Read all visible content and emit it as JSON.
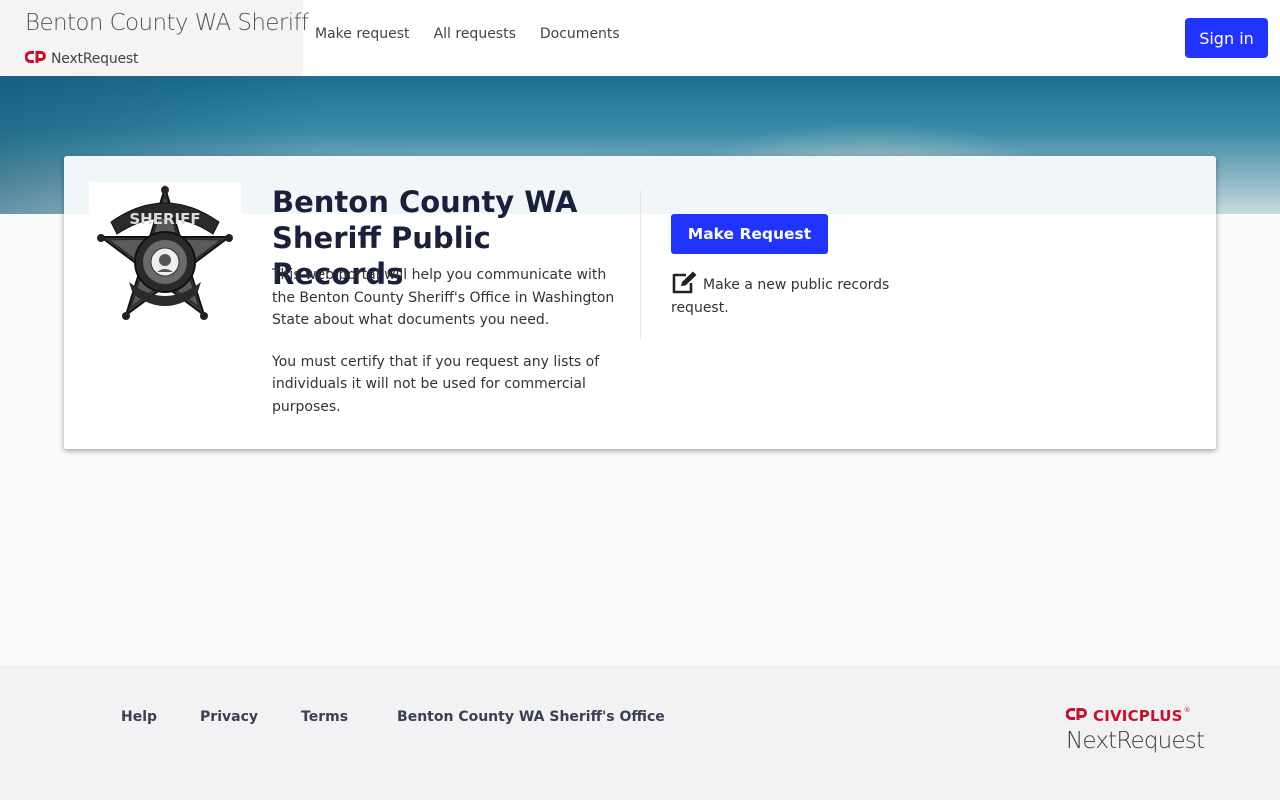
{
  "header": {
    "title": "Benton County WA Sheriff",
    "product_name": "NextRequest",
    "nav": [
      {
        "label": "Make request"
      },
      {
        "label": "All requests"
      },
      {
        "label": "Documents"
      }
    ],
    "sign_in_label": "Sign in"
  },
  "card": {
    "badge_icon": "sheriff-badge-icon",
    "title": "Benton County WA Sheriff Public Records",
    "description": [
      "This web portal will help you communicate with the Benton County Sheriff's Office in Washington State about what documents you need.",
      "You must certify that if you request any lists of individuals it will not be used for commercial purposes."
    ],
    "make_request_button": "Make Request",
    "make_request_icon": "edit-icon",
    "make_request_text": "Make a new public records request."
  },
  "footer": {
    "links": [
      {
        "label": "Help"
      },
      {
        "label": "Privacy"
      },
      {
        "label": "Terms"
      },
      {
        "label": "Benton County WA Sheriff's Office"
      }
    ],
    "logo_brand": "CIVICPLUS",
    "logo_product": "NextRequest"
  },
  "colors": {
    "accent": "#2134ff",
    "brand_red": "#c8102e",
    "title_navy": "#1c1f3c"
  }
}
